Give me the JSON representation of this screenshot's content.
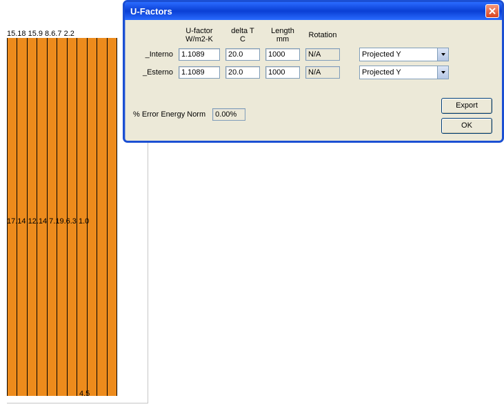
{
  "dialog": {
    "title": "U-Factors",
    "headers": {
      "ufactor": "U-factor\nW/m2-K",
      "deltaT": "delta T\nC",
      "length": "Length\nmm",
      "rotation": "Rotation"
    },
    "rows": [
      {
        "label": "_Interno",
        "ufactor": "1.1089",
        "deltaT": "20.0",
        "length": "1000",
        "rotation": "N/A",
        "proj": "Projected Y"
      },
      {
        "label": "_Esterno",
        "ufactor": "1.1089",
        "deltaT": "20.0",
        "length": "1000",
        "rotation": "N/A",
        "proj": "Projected Y"
      }
    ],
    "errorLabel": "% Error Energy Norm",
    "errorValue": "0.00%",
    "buttons": {
      "export": "Export",
      "ok": "OK"
    }
  },
  "viz": {
    "stripeCount": 11,
    "topLabels": "15.18 15.9 8.6.7  2.2",
    "midLabels": "17.14 12.14 7.19.6.3 1.0",
    "bottomLabel": "4.5"
  }
}
